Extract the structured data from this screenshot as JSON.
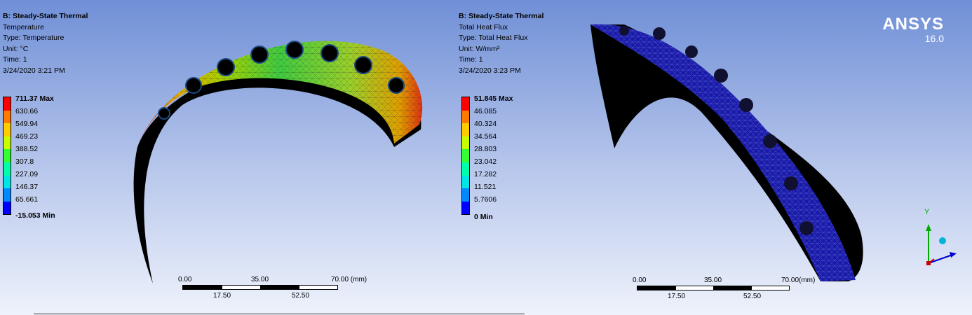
{
  "left_view": {
    "title": "B: Steady-State Thermal",
    "result_name": "Temperature",
    "type_line": "Type: Temperature",
    "unit_line": "Unit: °C",
    "time_line": "Time: 1",
    "timestamp": "3/24/2020 3:21 PM",
    "legend": {
      "colors": [
        "#ff0000",
        "#ff7a00",
        "#ffcc00",
        "#c8ff00",
        "#33ff33",
        "#00ffaa",
        "#00e6e6",
        "#0088ff",
        "#0000ff"
      ],
      "labels": [
        "711.37 Max",
        "630.66",
        "549.94",
        "469.23",
        "388.52",
        "307.8",
        "227.09",
        "146.37",
        "65.661",
        "-15.053 Min"
      ]
    },
    "scale": {
      "top_labels": [
        "0.00",
        "35.00",
        "70.00 (mm)"
      ],
      "bottom_labels": [
        "17.50",
        "52.50"
      ]
    }
  },
  "right_view": {
    "title": "B: Steady-State Thermal",
    "result_name": "Total Heat Flux",
    "type_line": "Type: Total Heat Flux",
    "unit_line": "Unit: W/mm²",
    "time_line": "Time: 1",
    "timestamp": "3/24/2020 3:23 PM",
    "legend": {
      "colors": [
        "#ff0000",
        "#ff7a00",
        "#ffcc00",
        "#c8ff00",
        "#33ff33",
        "#00ffaa",
        "#00e6e6",
        "#0088ff",
        "#0000ff"
      ],
      "labels": [
        "51.845 Max",
        "46.085",
        "40.324",
        "34.564",
        "28.803",
        "23.042",
        "17.282",
        "11.521",
        "5.7606",
        "0 Min"
      ]
    },
    "scale": {
      "top_labels": [
        "0.00",
        "35.00",
        "70.00(mm)"
      ],
      "bottom_labels": [
        "17.50",
        "52.50"
      ]
    }
  },
  "logo": {
    "name": "ANSYS",
    "version": "16.0"
  },
  "triad": {
    "y_label": "Y"
  }
}
